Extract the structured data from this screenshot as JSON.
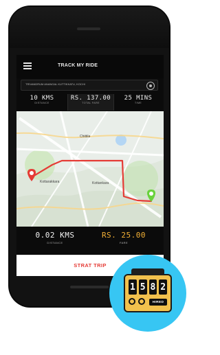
{
  "app": {
    "title": "TRACK MY RIDE"
  },
  "search": {
    "value": "TRIVANDRUM ANANGAL KUTTIKKATU, KOCHI"
  },
  "stats": [
    {
      "value": "10 KMS",
      "label": "DISTANCE"
    },
    {
      "value": "RS. 137.00",
      "label": "TOTAL FARE"
    },
    {
      "value": "25 MINS",
      "label": "TIME"
    }
  ],
  "map": {
    "labels": [
      {
        "text": "Chittila"
      },
      {
        "text": "Kottarakkara"
      },
      {
        "text": "Kottankara"
      }
    ],
    "colors": {
      "route": "#e53b35",
      "start_pin": "#e53b35",
      "end_pin": "#68d23b"
    }
  },
  "bottom_stats": {
    "distance": {
      "value": "0.02 KMS",
      "label": "DISTANCE"
    },
    "fare": {
      "value": "RS. 25.00",
      "label": "FARE"
    }
  },
  "actions": {
    "primary_label": "STRAT TRIP"
  },
  "badge": {
    "digits": [
      "1",
      "5",
      "8",
      "2"
    ],
    "status": "HIRED",
    "icon": "taxi-meter-icon"
  }
}
